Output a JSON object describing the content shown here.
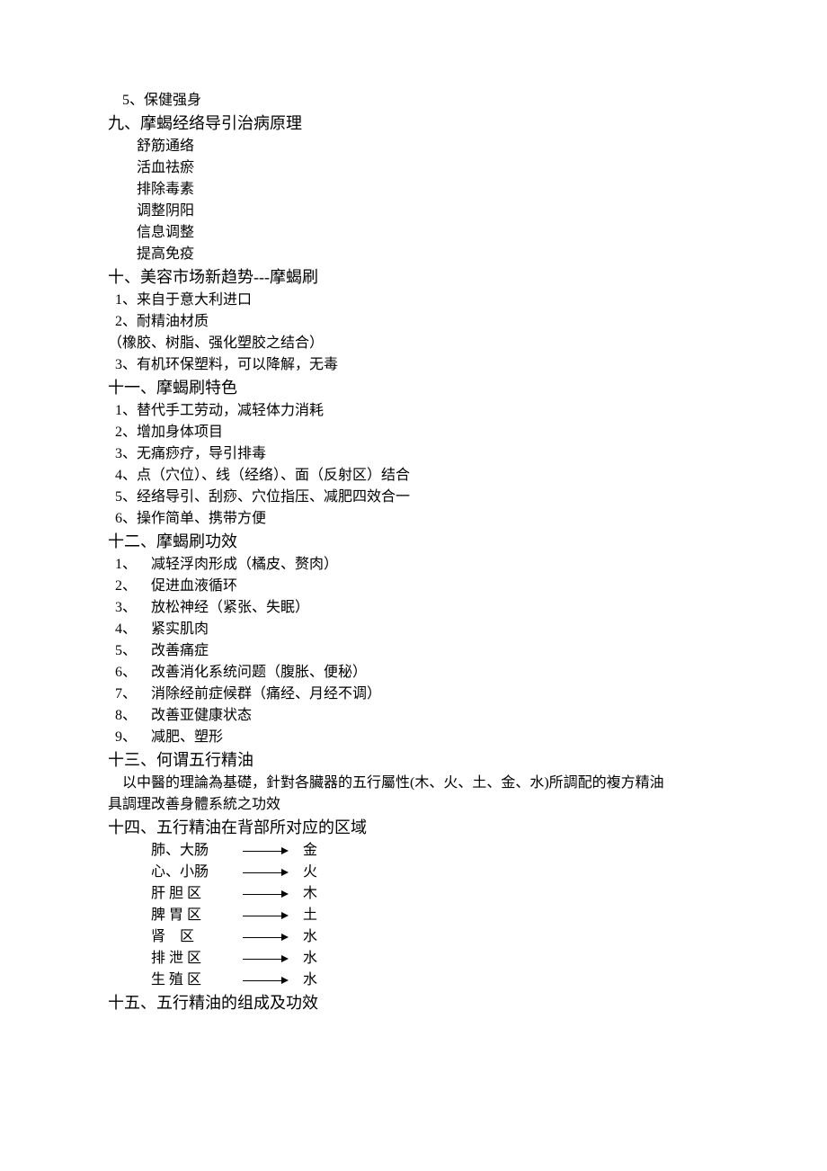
{
  "pre_item": "5、保健强身",
  "s9": {
    "heading": "九、摩蝎经络导引治病原理",
    "items": [
      "舒筋通络",
      "活血祛瘀",
      "排除毒素",
      "调整阴阳",
      "信息调整",
      "提高免疫"
    ]
  },
  "s10": {
    "heading": "十、美容市场新趋势---摩蝎刷",
    "items": [
      "1、来自于意大利进口",
      "2、耐精油材质",
      "（橡胶、树脂、强化塑胶之结合）",
      "3、有机环保塑料，可以降解，无毒"
    ]
  },
  "s11": {
    "heading": "十一、摩蝎刷特色",
    "items": [
      "1、替代手工劳动，减轻体力消耗",
      "2、增加身体项目",
      "3、无痛痧疗，导引排毒",
      "4、点（穴位）、线（经络）、面（反射区）结合",
      "5、经络导引、刮痧、穴位指压、减肥四效合一",
      "6、操作简单、携带方便"
    ]
  },
  "s12": {
    "heading": "十二、摩蝎刷功效",
    "items": [
      "1、    减轻浮肉形成（橘皮、赘肉）",
      "2、    促进血液循环",
      "3、    放松神经（紧张、失眠）",
      "4、    紧实肌肉",
      "5、    改善痛症",
      "6、    改善消化系统问题（腹胀、便秘）",
      "7、    消除经前症候群（痛经、月经不调）",
      "8、    改善亚健康状态",
      "9、    减肥、塑形"
    ]
  },
  "s13": {
    "heading": "十三、何谓五行精油",
    "body": [
      "    以中醫的理論為基礎，針對各臟器的五行屬性(木、火、土、金、水)所調配的複方精油",
      "具調理改善身體系統之功效"
    ]
  },
  "s14": {
    "heading": "十四、五行精油在背部所对应的区域",
    "rows": [
      {
        "label": "肺、大肠",
        "target": "金"
      },
      {
        "label": "心、小肠",
        "target": "火"
      },
      {
        "label": "肝 胆 区",
        "target": "木"
      },
      {
        "label": "脾 胃 区",
        "target": "土"
      },
      {
        "label": "肾    区",
        "target": "水"
      },
      {
        "label": "排 泄 区",
        "target": "水"
      },
      {
        "label": "生 殖 区",
        "target": "水"
      }
    ]
  },
  "s15": {
    "heading": "十五、五行精油的组成及功效"
  }
}
